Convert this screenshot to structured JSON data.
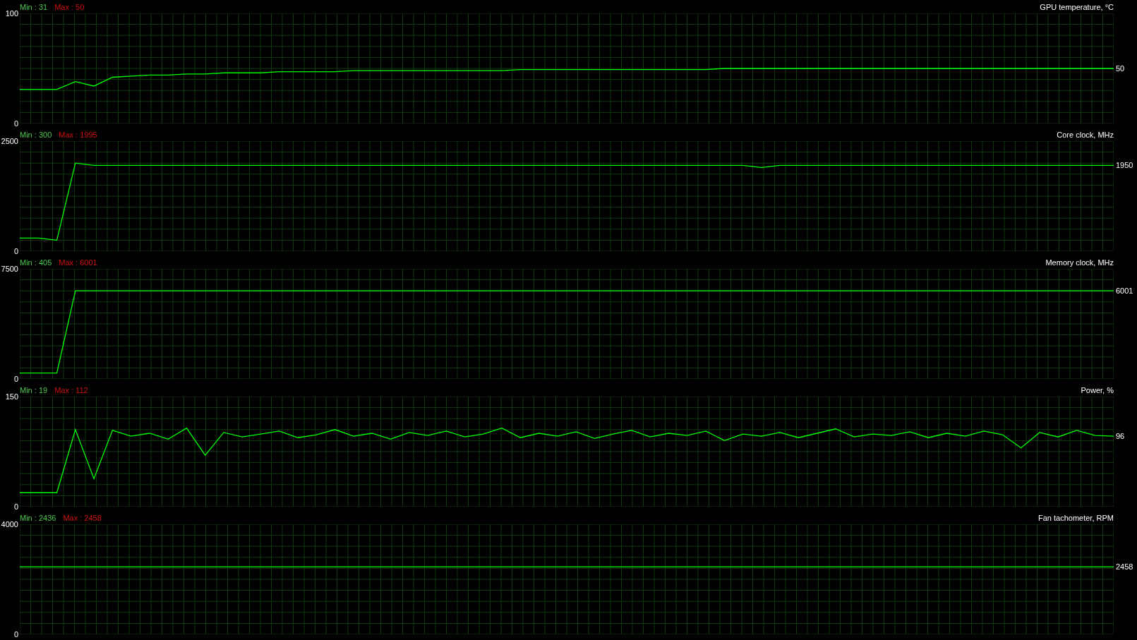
{
  "graphs": [
    {
      "min_label": "Min : 31",
      "max_label": "Max : 50",
      "current": "50",
      "chart_data": {
        "type": "line",
        "title": "GPU temperature, °C",
        "grid": true,
        "ylim": [
          0,
          100
        ],
        "yticks": [
          0,
          100
        ],
        "series": [
          {
            "color": "#00ff00",
            "values": [
              31,
              31,
              31,
              38,
              34,
              42,
              43,
              44,
              44,
              45,
              45,
              46,
              46,
              46,
              47,
              47,
              47,
              47,
              48,
              48,
              48,
              48,
              48,
              48,
              48,
              48,
              48,
              49,
              49,
              49,
              49,
              49,
              49,
              49,
              49,
              49,
              49,
              49,
              50,
              50,
              50,
              50,
              50,
              50,
              50,
              50,
              50,
              50,
              50,
              50,
              50,
              50,
              50,
              50,
              50,
              50,
              50,
              50,
              50,
              50
            ]
          }
        ]
      }
    },
    {
      "min_label": "Min : 300",
      "max_label": "Max : 1995",
      "current": "1950",
      "chart_data": {
        "type": "line",
        "title": "Core clock, MHz",
        "grid": true,
        "ylim": [
          0,
          2500
        ],
        "yticks": [
          0,
          2500
        ],
        "series": [
          {
            "color": "#00ff00",
            "values": [
              300,
              300,
              250,
              2000,
              1950,
              1950,
              1950,
              1950,
              1950,
              1950,
              1950,
              1950,
              1950,
              1950,
              1950,
              1950,
              1950,
              1950,
              1950,
              1950,
              1950,
              1950,
              1950,
              1950,
              1950,
              1950,
              1950,
              1950,
              1950,
              1950,
              1950,
              1950,
              1950,
              1950,
              1950,
              1950,
              1950,
              1950,
              1950,
              1950,
              1900,
              1950,
              1950,
              1950,
              1950,
              1950,
              1950,
              1950,
              1950,
              1950,
              1950,
              1950,
              1950,
              1950,
              1950,
              1950,
              1950,
              1950,
              1950,
              1950
            ]
          }
        ]
      }
    },
    {
      "min_label": "Min : 405",
      "max_label": "Max : 6001",
      "current": "6001",
      "chart_data": {
        "type": "line",
        "title": "Memory clock, MHz",
        "grid": true,
        "ylim": [
          0,
          7500
        ],
        "yticks": [
          0,
          7500
        ],
        "series": [
          {
            "color": "#00ff00",
            "values": [
              400,
              400,
              400,
              6000,
              6000,
              6000,
              6000,
              6000,
              6000,
              6000,
              6000,
              6000,
              6000,
              6000,
              6000,
              6000,
              6000,
              6000,
              6000,
              6000,
              6000,
              6000,
              6000,
              6000,
              6000,
              6000,
              6000,
              6000,
              6000,
              6000,
              6000,
              6000,
              6000,
              6000,
              6000,
              6000,
              6000,
              6000,
              6000,
              6000,
              6000,
              6000,
              6000,
              6000,
              6000,
              6000,
              6000,
              6000,
              6000,
              6000,
              6000,
              6000,
              6000,
              6000,
              6000,
              6000,
              6000,
              6000,
              6000,
              6000
            ]
          }
        ]
      }
    },
    {
      "min_label": "Min : 19",
      "max_label": "Max : 112",
      "current": "96",
      "chart_data": {
        "type": "line",
        "title": "Power, %",
        "grid": true,
        "ylim": [
          0,
          150
        ],
        "yticks": [
          0,
          150
        ],
        "series": [
          {
            "color": "#00ff00",
            "values": [
              19,
              19,
              19,
              105,
              38,
              104,
              96,
              100,
              92,
              107,
              70,
              101,
              95,
              99,
              103,
              94,
              98,
              105,
              96,
              100,
              92,
              101,
              97,
              103,
              95,
              99,
              107,
              94,
              100,
              96,
              102,
              93,
              99,
              104,
              95,
              100,
              97,
              103,
              90,
              99,
              96,
              101,
              94,
              100,
              106,
              95,
              99,
              97,
              102,
              94,
              100,
              96,
              103,
              98,
              80,
              101,
              95,
              104,
              97,
              96
            ]
          }
        ]
      }
    },
    {
      "min_label": "Min : 2436",
      "max_label": "Max : 2458",
      "current": "2458",
      "chart_data": {
        "type": "line",
        "title": "Fan tachometer, RPM",
        "grid": true,
        "ylim": [
          0,
          4000
        ],
        "yticks": [
          0,
          4000
        ],
        "series": [
          {
            "color": "#00ff00",
            "values": [
              2450,
              2450,
              2450,
              2450,
              2450,
              2450,
              2450,
              2450,
              2450,
              2450,
              2450,
              2450,
              2450,
              2450,
              2450,
              2450,
              2450,
              2450,
              2450,
              2450,
              2450,
              2450,
              2450,
              2450,
              2450,
              2450,
              2450,
              2450,
              2450,
              2450,
              2450,
              2450,
              2450,
              2450,
              2450,
              2450,
              2450,
              2450,
              2450,
              2450,
              2450,
              2450,
              2450,
              2450,
              2450,
              2450,
              2450,
              2450,
              2450,
              2450,
              2450,
              2450,
              2450,
              2450,
              2450,
              2450,
              2450,
              2450,
              2450,
              2450
            ]
          }
        ]
      }
    }
  ]
}
